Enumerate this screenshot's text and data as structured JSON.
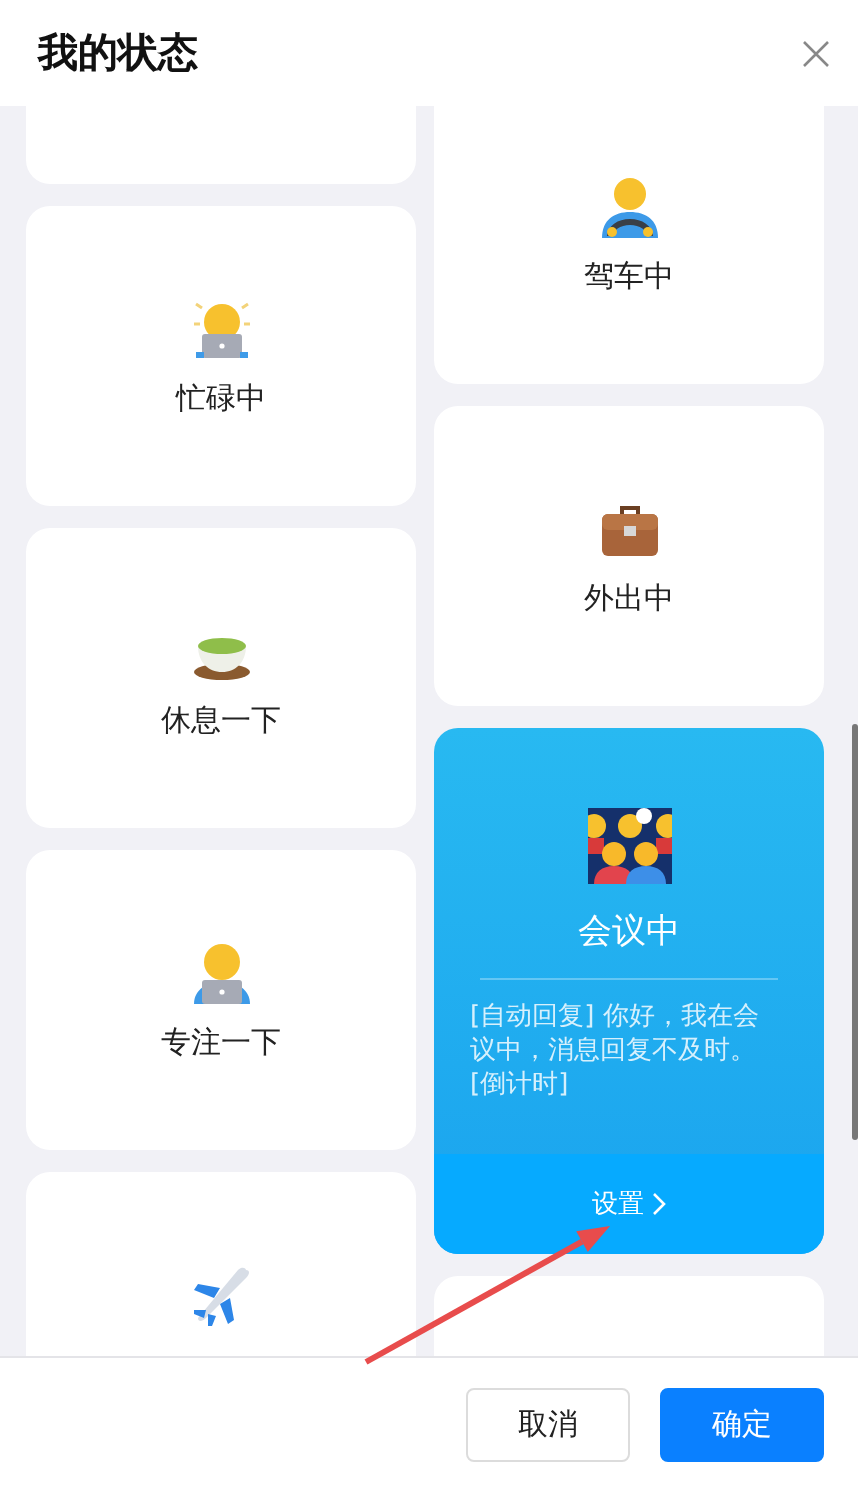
{
  "title": "我的状态",
  "columns": [
    {
      "cards": [
        {
          "kind": "blank",
          "selected": false
        },
        {
          "label": "忙碌中",
          "kind": "busy",
          "selected": false
        },
        {
          "label": "休息一下",
          "kind": "tea",
          "selected": false
        },
        {
          "label": "专注一下",
          "kind": "focus",
          "selected": false
        },
        {
          "kind": "plane",
          "selected": false
        }
      ]
    },
    {
      "cards": [
        {
          "label": "驾车中",
          "kind": "driving",
          "selected": false
        },
        {
          "label": "外出中",
          "kind": "briefcase",
          "selected": false
        },
        {
          "label": "会议中",
          "kind": "meeting",
          "selected": true,
          "auto_reply": "[自动回复] 你好，我在会议中，消息回复不及时。[倒计时]",
          "settings": "设置"
        },
        {
          "kind": "blank",
          "selected": false
        }
      ]
    }
  ],
  "buttons": [
    {
      "label": "取消",
      "kind": "secondary"
    },
    {
      "label": "确定",
      "kind": "primary"
    }
  ]
}
